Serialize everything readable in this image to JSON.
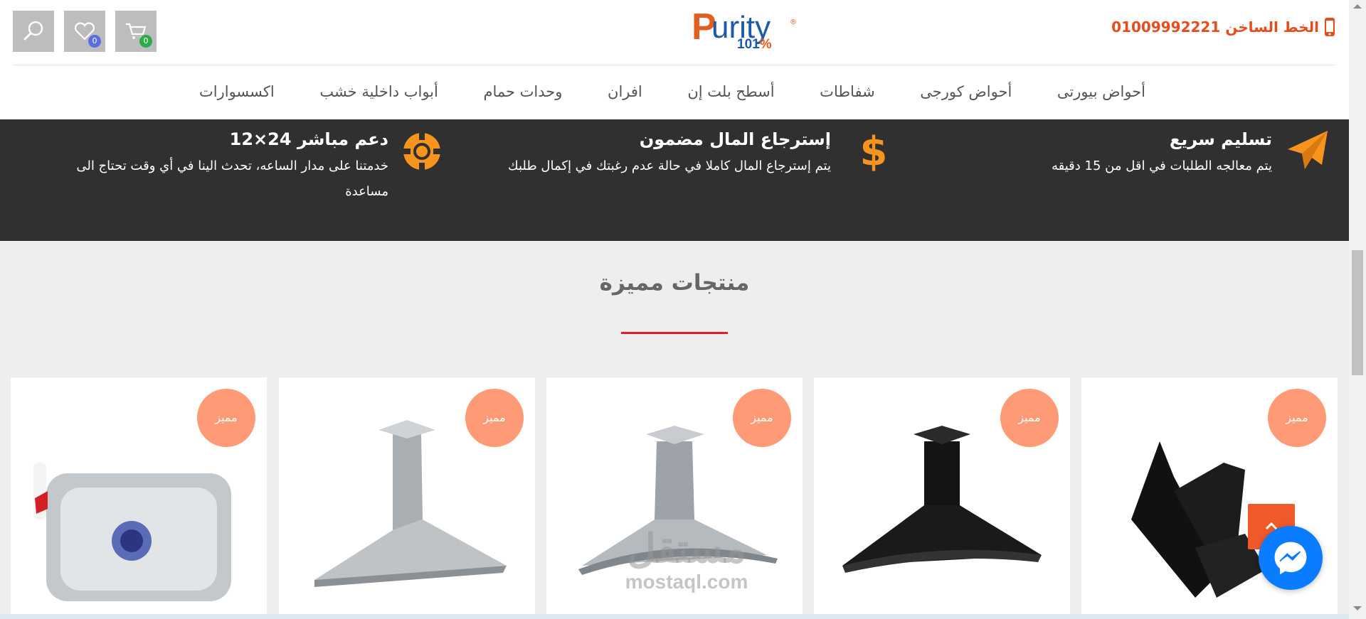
{
  "header": {
    "search_icon": "search-icon",
    "wishlist": {
      "icon": "heart-icon",
      "count": "0",
      "badge_color": "#5b6ee1"
    },
    "cart": {
      "icon": "cart-icon",
      "count": "0",
      "badge_color": "#2eaa4a"
    },
    "logo": {
      "p": "P",
      "rest": "urity",
      "num": "101",
      "pct": "%",
      "reg": "®"
    },
    "hotline": {
      "label": "الخط الساخن 01009992221",
      "icon": "phone-icon",
      "color": "#e84b1c"
    }
  },
  "nav": {
    "items": [
      "أحواض بيورتى",
      "أحواض كورجى",
      "شفاطات",
      "أسطح بلت إن",
      "افران",
      "وحدات حمام",
      "أبواب داخلية خشب",
      "اكسسوارات"
    ]
  },
  "features": [
    {
      "icon": "paper-plane-icon",
      "title": "تسليم سريع",
      "desc": "يتم معالجه الطلبات في اقل من 15 دقيقه"
    },
    {
      "icon": "dollar-icon",
      "title": "إسترجاع المال مضمون",
      "desc": "يتم إسترجاع المال كاملا في حالة عدم رغبتك في إكمال طلبك"
    },
    {
      "icon": "life-ring-icon",
      "title": "دعم مباشر 24×12",
      "desc": "خدمتنا على مدار الساعه، تحدث الينا في أي وقت تحتاج الى مساعدة"
    }
  ],
  "section": {
    "title": "منتجات مميزة",
    "accent": "#e01e24"
  },
  "products": [
    {
      "badge": "مميز",
      "image": "black-angled-hood"
    },
    {
      "badge": "مميز",
      "image": "black-curved-hood"
    },
    {
      "badge": "مميز",
      "image": "steel-glass-hood"
    },
    {
      "badge": "مميز",
      "image": "steel-pyramid-hood"
    },
    {
      "badge": "مميز",
      "image": "steel-sink"
    }
  ],
  "watermark": {
    "ar": "مستقل",
    "en": "mostaql.com"
  },
  "floating": {
    "back_to_top_icon": "chevron-up-icon",
    "messenger_icon": "messenger-icon"
  },
  "colors": {
    "orange": "#e84b1c",
    "dark_band": "#303030",
    "badge": "#ff9a76",
    "feature_icon": "#f7941d"
  }
}
